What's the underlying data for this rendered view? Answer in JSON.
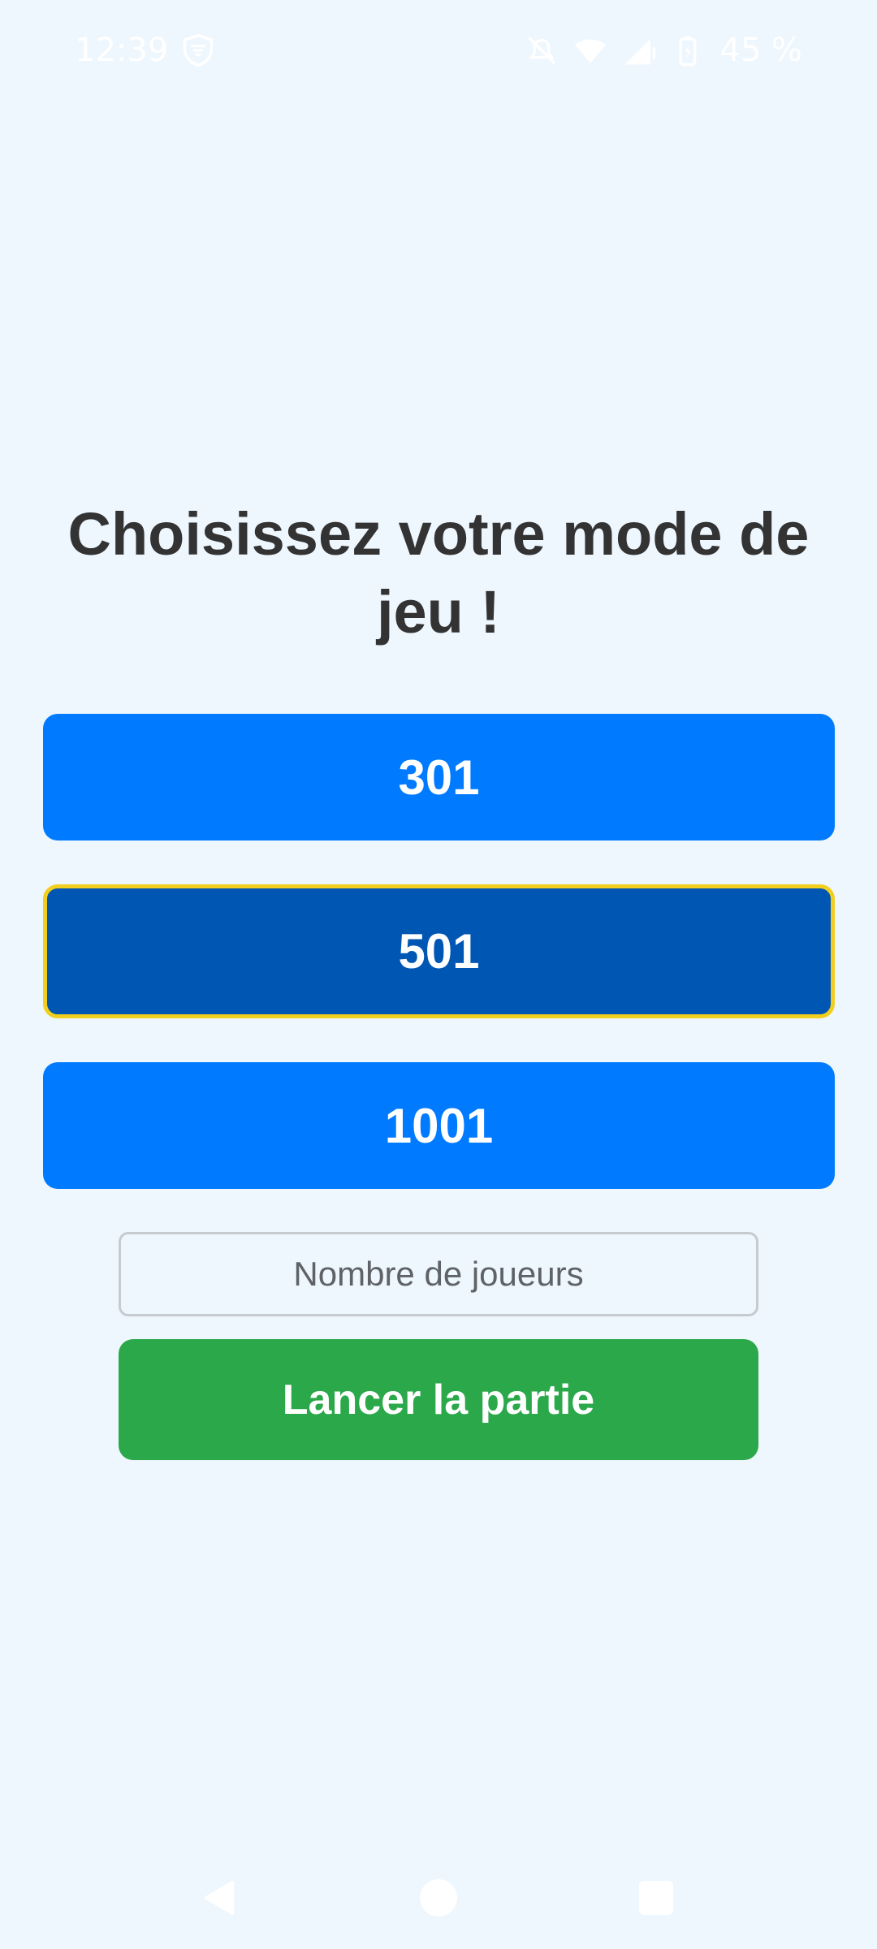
{
  "status_bar": {
    "time": "12:39",
    "battery": "45 %",
    "icons": [
      "vpn-icon",
      "mute-icon",
      "wifi-icon",
      "signal-icon",
      "battery-icon"
    ]
  },
  "title": "Choisissez votre mode de jeu !",
  "modes": [
    {
      "label": "301",
      "selected": false
    },
    {
      "label": "501",
      "selected": true
    },
    {
      "label": "1001",
      "selected": false
    }
  ],
  "players_input": {
    "placeholder": "Nombre de joueurs",
    "value": ""
  },
  "launch_button": {
    "label": "Lancer la partie"
  },
  "nav_bar": {
    "icons": [
      "back-icon",
      "home-icon",
      "recents-icon"
    ]
  },
  "colors": {
    "background": "#eef6fe",
    "mode_button": "#007bff",
    "mode_button_selected": "#0056b3",
    "selected_border": "#f2cf1e",
    "launch_button": "#2ba84a",
    "title_text": "#333333"
  }
}
